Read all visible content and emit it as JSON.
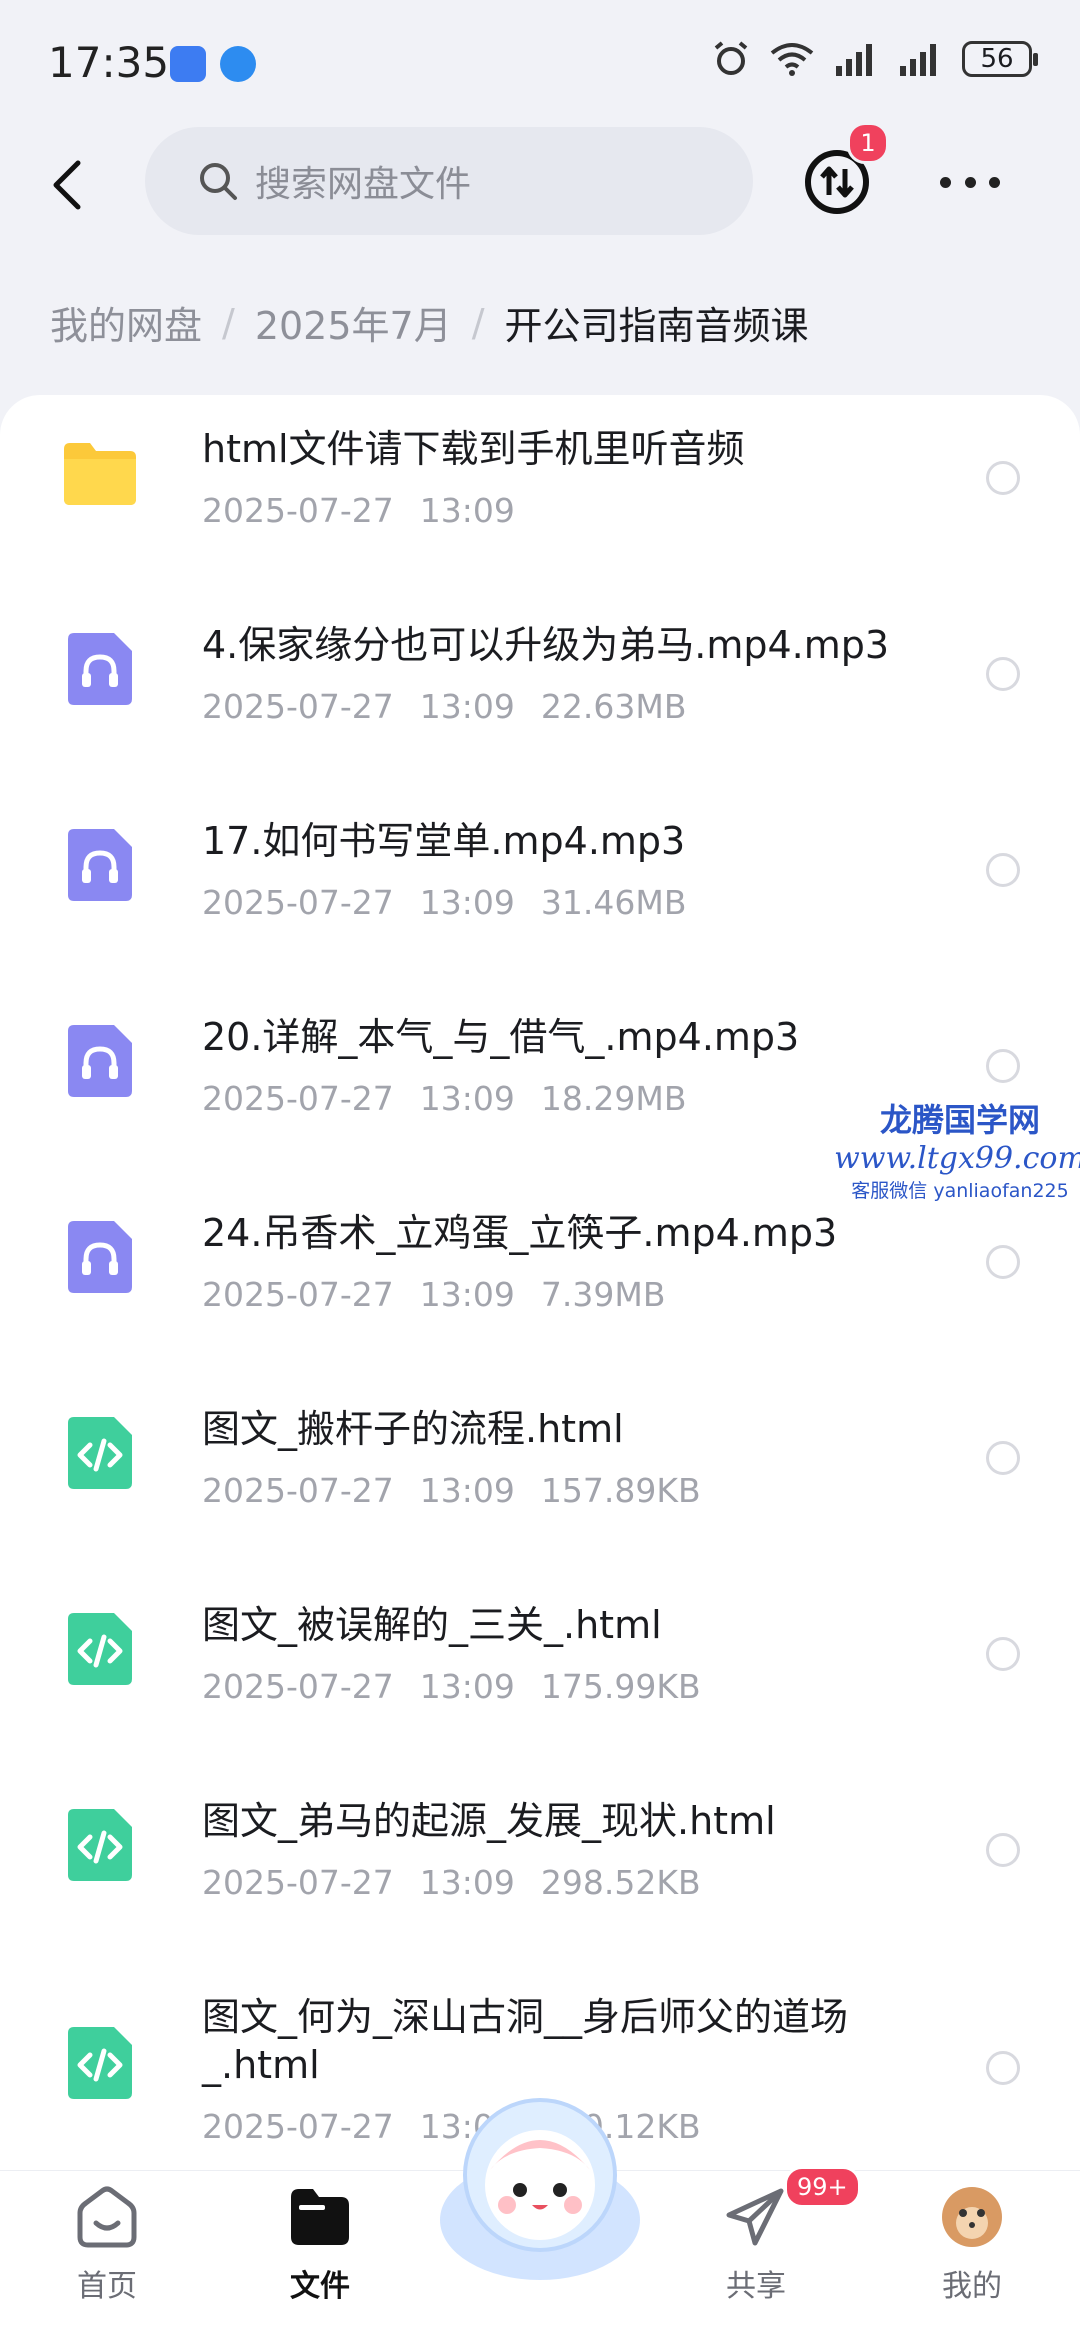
{
  "status_bar": {
    "time": "17:35",
    "battery": "56"
  },
  "top_bar": {
    "search_placeholder": "搜索网盘文件",
    "transfer_badge": "1"
  },
  "breadcrumb": [
    "我的网盘",
    "2025年7月",
    "开公司指南音频课"
  ],
  "files": [
    {
      "type": "folder",
      "name": "html文件请下载到手机里听音频",
      "date": "2025-07-27",
      "time": "13:09",
      "size": ""
    },
    {
      "type": "audio",
      "name": "4.保家缘分也可以升级为弟马.mp4.mp3",
      "date": "2025-07-27",
      "time": "13:09",
      "size": "22.63MB"
    },
    {
      "type": "audio",
      "name": "17.如何书写堂单.mp4.mp3",
      "date": "2025-07-27",
      "time": "13:09",
      "size": "31.46MB"
    },
    {
      "type": "audio",
      "name": "20.详解_本气_与_借气_.mp4.mp3",
      "date": "2025-07-27",
      "time": "13:09",
      "size": "18.29MB"
    },
    {
      "type": "audio",
      "name": "24.吊香术_立鸡蛋_立筷子.mp4.mp3",
      "date": "2025-07-27",
      "time": "13:09",
      "size": "7.39MB"
    },
    {
      "type": "html",
      "name": "图文_搬杆子的流程.html",
      "date": "2025-07-27",
      "time": "13:09",
      "size": "157.89KB"
    },
    {
      "type": "html",
      "name": "图文_被误解的_三关_.html",
      "date": "2025-07-27",
      "time": "13:09",
      "size": "175.99KB"
    },
    {
      "type": "html",
      "name": "图文_弟马的起源_发展_现状.html",
      "date": "2025-07-27",
      "time": "13:09",
      "size": "298.52KB"
    },
    {
      "type": "html",
      "name": "图文_何为_深山古洞__身后师父的道场",
      "name2": "_.html",
      "date": "2025-07-27",
      "time": "13:09",
      "size": "130.12KB"
    }
  ],
  "watermark": {
    "title": "龙腾国学网",
    "url": "www.ltgx99.com",
    "sub": "客服微信 yanliaofan225"
  },
  "bottom_nav": {
    "home": "首页",
    "files": "文件",
    "share": "共享",
    "share_badge": "99+",
    "mine": "我的"
  },
  "colors": {
    "folder": "#fcc93a",
    "audio": "#8a88f2",
    "html": "#3fcf9c",
    "badge": "#f0415d"
  }
}
